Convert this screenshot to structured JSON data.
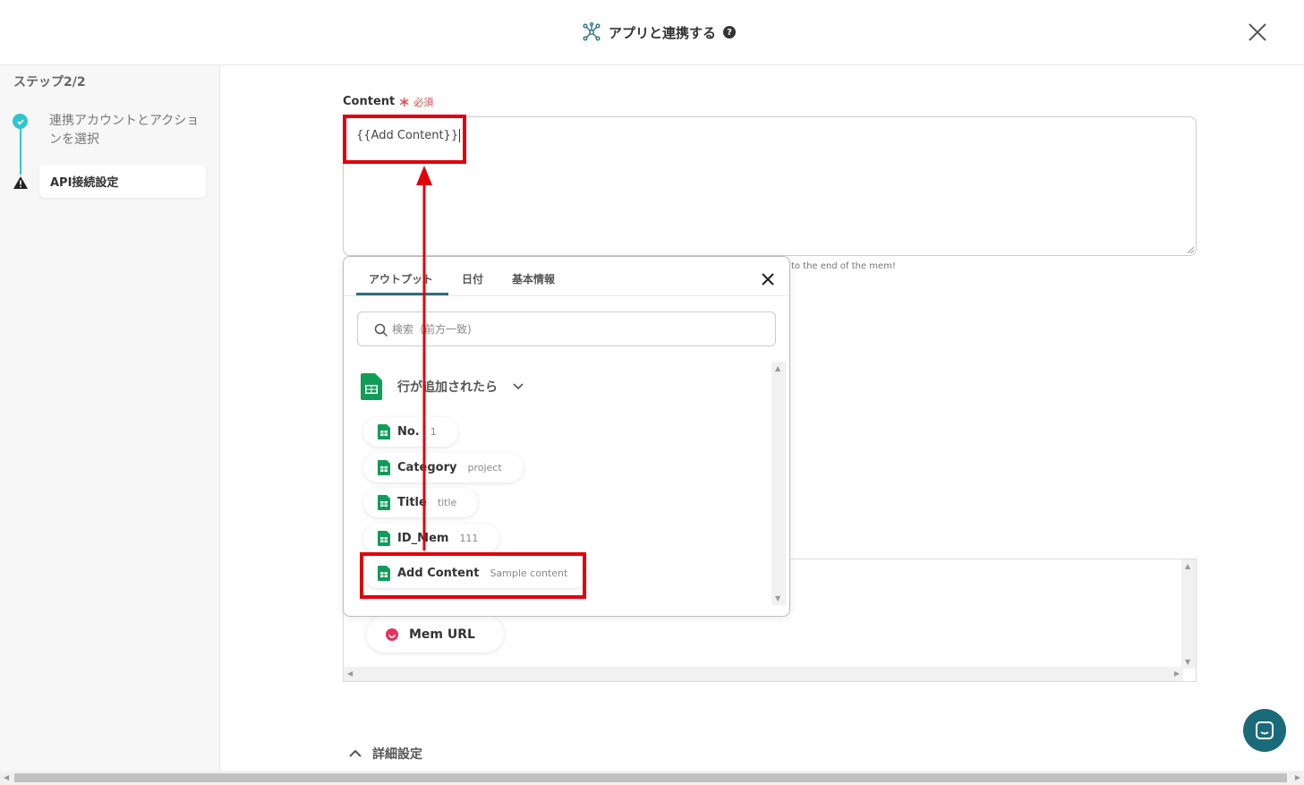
{
  "header": {
    "title": "アプリと連携する",
    "help_icon": "question-circle-icon",
    "title_icon": "network-icon"
  },
  "sidebar": {
    "step_label": "ステップ2/2",
    "steps": [
      {
        "label": "連携アカウントとアクションを選択",
        "status": "done"
      },
      {
        "label": "API接続設定",
        "status": "warning"
      }
    ]
  },
  "form": {
    "content_label": "Content",
    "required_mark": "＊",
    "required_text": "必須",
    "content_value": "{{Add Content}}",
    "helper_text": "l to the end of the mem!"
  },
  "popup": {
    "tabs": [
      {
        "label": "アウトプット",
        "active": true
      },
      {
        "label": "日付"
      },
      {
        "label": "基本情報"
      }
    ],
    "search_placeholder": "検索（前方一致)",
    "group_label": "行が追加されたら",
    "items": [
      {
        "label": "No.",
        "value": "1"
      },
      {
        "label": "Category",
        "value": "project"
      },
      {
        "label": "Title",
        "value": "title"
      },
      {
        "label": "ID_Mem",
        "value": "111"
      },
      {
        "label": "Add Content",
        "value": "Sample content"
      }
    ]
  },
  "lower": {
    "mem_chip": "Mem URL"
  },
  "details": {
    "label": "詳細設定"
  },
  "colors": {
    "accent": "#2fc5cf",
    "highlight": "#e0000c",
    "tab_active": "#2a6f80",
    "chat": "#1b6a7a",
    "sheets": "#0f9d58"
  }
}
